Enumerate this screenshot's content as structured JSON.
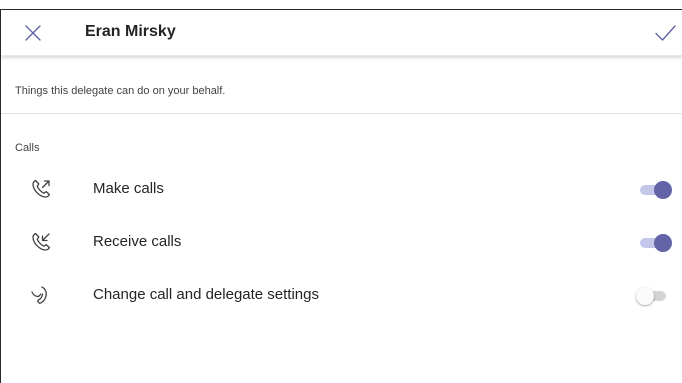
{
  "header": {
    "title": "Eran Mirsky",
    "close_icon": "close-icon",
    "confirm_icon": "checkmark-icon"
  },
  "description": "Things this delegate can do on your behalf.",
  "section": {
    "label": "Calls"
  },
  "permissions": [
    {
      "label": "Make calls",
      "icon": "outgoing-call-icon",
      "enabled": true
    },
    {
      "label": "Receive calls",
      "icon": "incoming-call-icon",
      "enabled": true
    },
    {
      "label": "Change call and delegate settings",
      "icon": "call-settings-icon",
      "enabled": false
    }
  ],
  "colors": {
    "accent": "#6264a7",
    "accent_light": "#c5c7ea",
    "toggle_off_track": "#d4d4d4"
  }
}
